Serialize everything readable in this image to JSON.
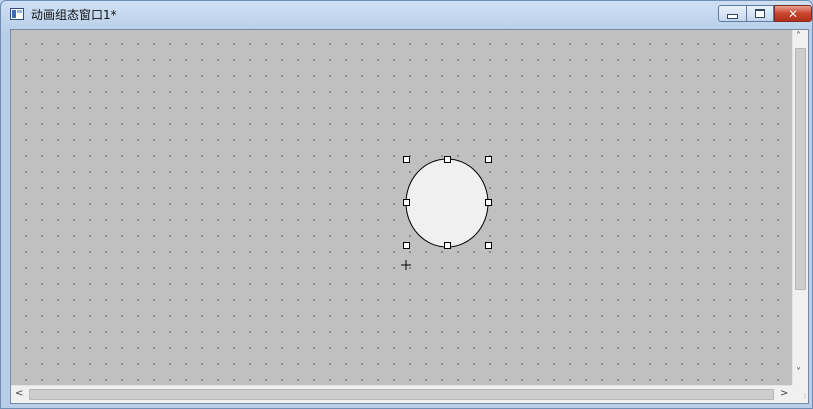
{
  "window": {
    "title": "动画组态窗口1*",
    "minimize_icon": "minimize-icon",
    "maximize_icon": "maximize-icon",
    "close_icon": "close-icon",
    "close_glyph": "✕"
  },
  "canvas": {
    "background_color": "#c0c0c0",
    "grid_dot_color": "#5a5a5a",
    "selected_shape": {
      "type": "ellipse",
      "fill": "#f0f0f0",
      "stroke": "#000000",
      "selection_handles": 8
    },
    "cursor_icon": "crosshair-icon"
  },
  "scrollbars": {
    "up_arrow": "˄",
    "down_arrow": "˅",
    "left_arrow": "<",
    "right_arrow": ">",
    "size_grip": "⁝"
  },
  "colors": {
    "title_bar": "#b9cfe9",
    "close_button": "#c8452c",
    "scrollbar_track": "#f0f0f0"
  }
}
